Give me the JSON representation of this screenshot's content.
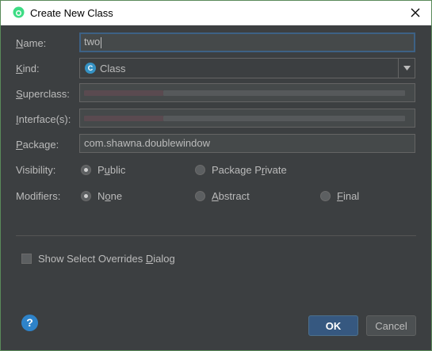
{
  "window": {
    "title": "Create New Class"
  },
  "form": {
    "name_label_pre": "",
    "name_label_u": "N",
    "name_label_post": "ame:",
    "name_value": "two",
    "kind_label_u": "K",
    "kind_label_post": "ind:",
    "kind_value": "Class",
    "kind_icon_letter": "C",
    "superclass_label_u": "S",
    "superclass_label_post": "uperclass:",
    "interfaces_label_u": "I",
    "interfaces_label_post": "nterface(s):",
    "package_label_u": "P",
    "package_label_post": "ackage:",
    "package_value": "com.shawna.doublewindow",
    "visibility_label": "Visibility:",
    "visibility_public_pre": "P",
    "visibility_public_u": "u",
    "visibility_public_post": "blic",
    "visibility_private_pre": "Package P",
    "visibility_private_u": "r",
    "visibility_private_post": "ivate",
    "modifiers_label": "Modifiers:",
    "mod_none_pre": "N",
    "mod_none_u": "o",
    "mod_none_post": "ne",
    "mod_abstract_u": "A",
    "mod_abstract_post": "bstract",
    "mod_final_u": "F",
    "mod_final_post": "inal",
    "show_overrides_pre": "Show Select Overrides ",
    "show_overrides_u": "D",
    "show_overrides_post": "ialog"
  },
  "buttons": {
    "ok": "OK",
    "cancel": "Cancel",
    "help": "?"
  },
  "state": {
    "visibility_selected": "Public",
    "modifier_selected": "None",
    "show_overrides_checked": false
  },
  "colors": {
    "background": "#3c3f41",
    "field": "#45494a",
    "accent": "#365880",
    "focus": "#3d6185"
  }
}
